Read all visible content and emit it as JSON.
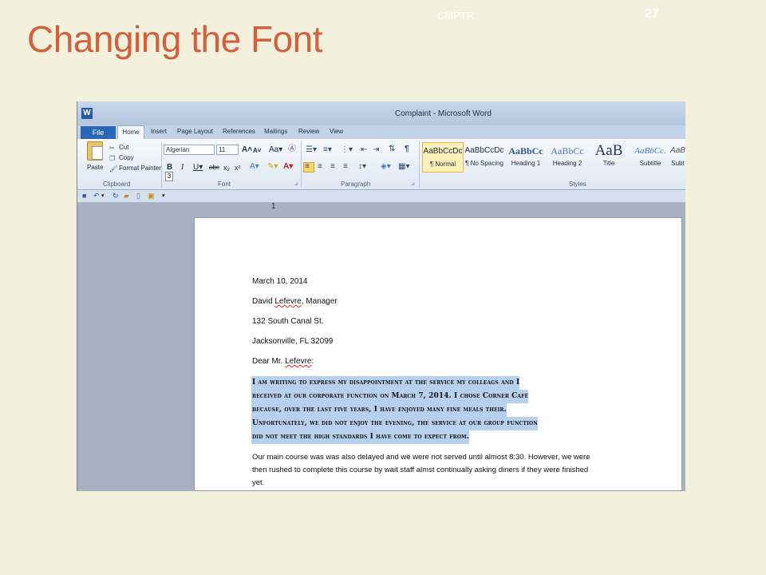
{
  "slide": {
    "title": "Changing the Font",
    "course": "CMPTR",
    "number": "27"
  },
  "window": {
    "app_icon": "W",
    "title": "Complaint - Microsoft Word"
  },
  "tabs": [
    "File",
    "Home",
    "Insert",
    "Page Layout",
    "References",
    "Mailings",
    "Review",
    "View"
  ],
  "ribbon": {
    "clipboard": {
      "paste": "Paste",
      "cut": "Cut",
      "copy": "Copy",
      "format_painter": "Format Painter",
      "label": "Clipboard"
    },
    "font": {
      "font_name": "Algerian",
      "font_size": "11",
      "label": "Font"
    },
    "paragraph": {
      "label": "Paragraph"
    },
    "styles": {
      "label": "Styles",
      "items": [
        {
          "sample": "AaBbCcDc",
          "name": "¶ Normal"
        },
        {
          "sample": "AaBbCcDc",
          "name": "¶ No Spacing"
        },
        {
          "sample": "AaBbCc",
          "name": "Heading 1"
        },
        {
          "sample": "AaBbCc",
          "name": "Heading 2"
        },
        {
          "sample": "AaB",
          "name": "Title"
        },
        {
          "sample": "AaBbCc.",
          "name": "Subtitle"
        },
        {
          "sample": "AaB",
          "name": "Subt"
        }
      ]
    }
  },
  "ruler": {
    "horizontal_mark": "1",
    "vertical_mark": "3"
  },
  "document": {
    "date": "March 10, 2014",
    "recipient_name": "David ",
    "recipient_surname": "Lefevre",
    "recipient_title": ", Manager",
    "street": "132 South Canal St.",
    "city": "Jacksonville, FL 32099",
    "salutation_start": "Dear Mr. ",
    "salutation_name": "Lefevre",
    "salutation_end": ":",
    "selected_lines": [
      "I am writing to express my disappointment at the service my colleags and I",
      "received at our corporate function on March 7, 2014. I chose Corner Café",
      "because, over the last five years, I have enjoyed many fine meals their.",
      "Unfortunately, we did not enjoy the evening, the service at our group function",
      "did not meet the high standards I have come to expect from."
    ],
    "body_lines": [
      "Our main course was was also delayed and we were not served until almost 8:30. However, we were",
      "then rushed to complete this course by wait staff almst continually asking diners if they were finished",
      "yet."
    ]
  }
}
